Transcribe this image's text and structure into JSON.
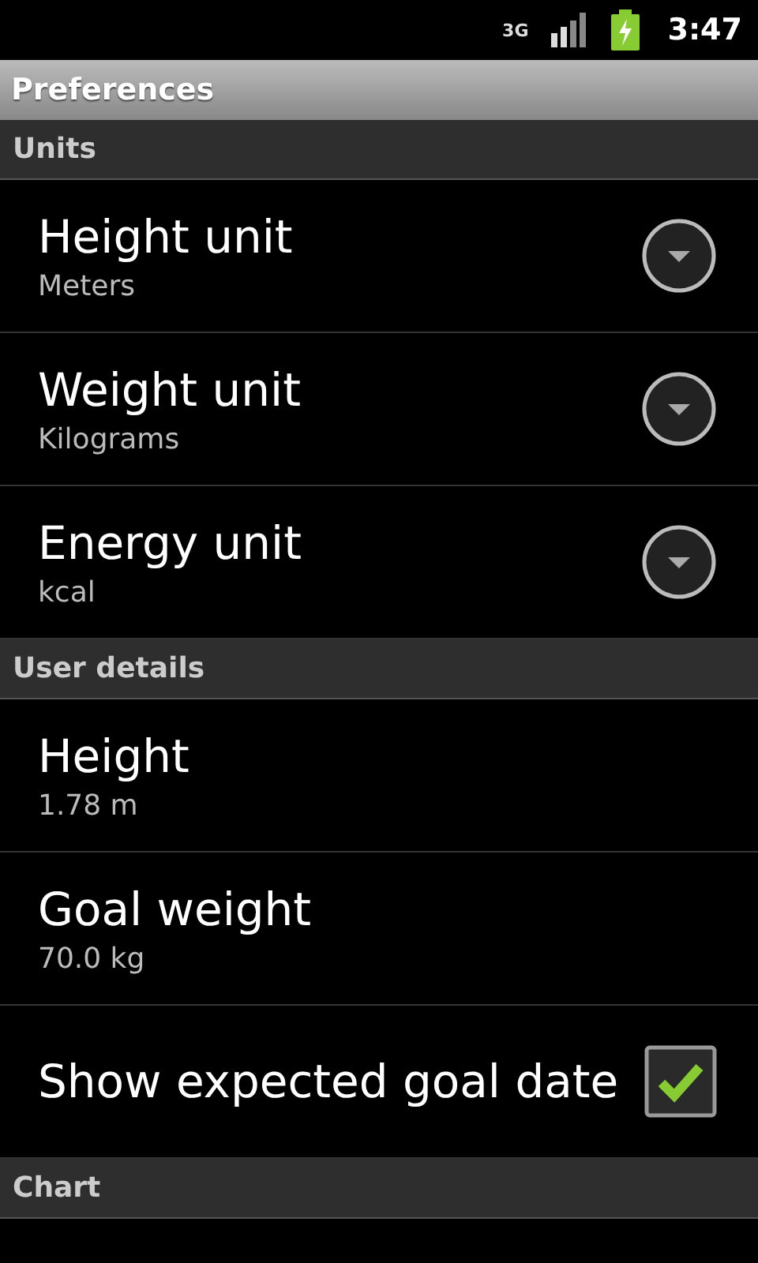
{
  "status_bar": {
    "network": "3G",
    "time": "3:47"
  },
  "title": "Preferences",
  "sections": [
    {
      "header": "Units",
      "items": [
        {
          "kind": "dropdown",
          "title": "Height unit",
          "summary": "Meters"
        },
        {
          "kind": "dropdown",
          "title": "Weight unit",
          "summary": "Kilograms"
        },
        {
          "kind": "dropdown",
          "title": "Energy unit",
          "summary": "kcal"
        }
      ]
    },
    {
      "header": "User details",
      "items": [
        {
          "kind": "plain",
          "title": "Height",
          "summary": "1.78 m"
        },
        {
          "kind": "plain",
          "title": "Goal weight",
          "summary": "70.0 kg"
        },
        {
          "kind": "checkbox",
          "title": "Show expected goal date",
          "checked": true
        }
      ]
    },
    {
      "header": "Chart"
    }
  ]
}
